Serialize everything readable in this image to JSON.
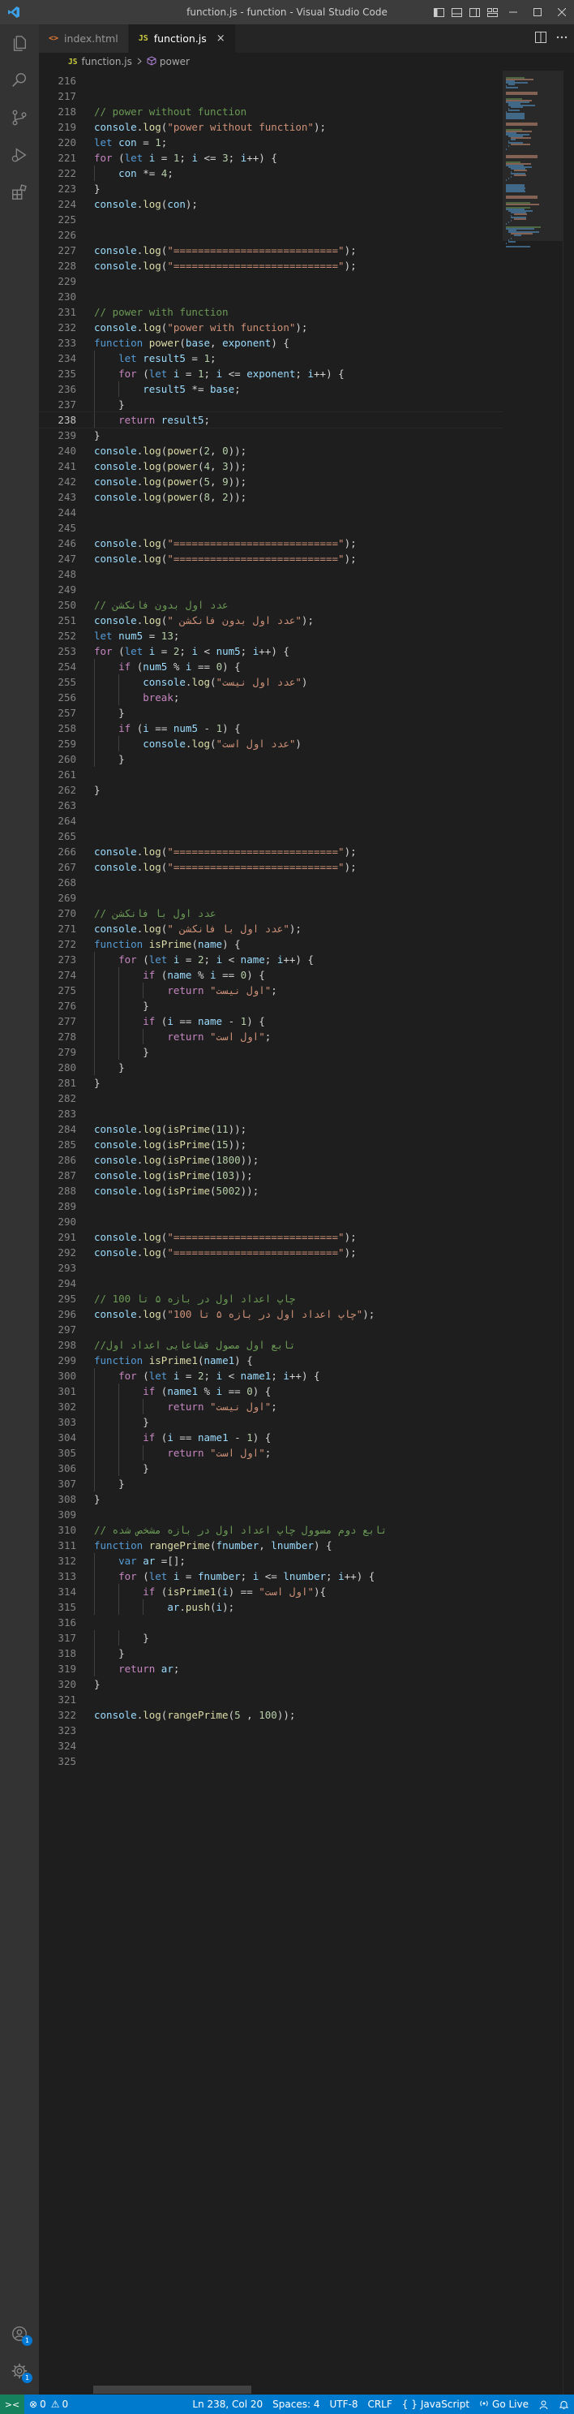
{
  "window": {
    "title": "function.js - function - Visual Studio Code"
  },
  "tabs": [
    {
      "label": "index.html",
      "icon": "html-file-icon",
      "active": false
    },
    {
      "label": "function.js",
      "icon": "js-file-icon",
      "active": true
    }
  ],
  "tab_icons": {
    "html": "<>",
    "js": "JS",
    "close": "×"
  },
  "breadcrumb": {
    "file": "function.js",
    "symbol": "power",
    "file_icon": "JS"
  },
  "editor": {
    "current_line": 238,
    "lines": [
      {
        "n": 216,
        "t": ""
      },
      {
        "n": 217,
        "t": ""
      },
      {
        "n": 218,
        "t": "// power without function"
      },
      {
        "n": 219,
        "t": "console.log(\"power without function\");"
      },
      {
        "n": 220,
        "t": "let con = 1;"
      },
      {
        "n": 221,
        "t": "for (let i = 1; i <= 3; i++) {"
      },
      {
        "n": 222,
        "t": "    con *= 4;"
      },
      {
        "n": 223,
        "t": "}"
      },
      {
        "n": 224,
        "t": "console.log(con);"
      },
      {
        "n": 225,
        "t": ""
      },
      {
        "n": 226,
        "t": ""
      },
      {
        "n": 227,
        "t": "console.log(\"===========================\");"
      },
      {
        "n": 228,
        "t": "console.log(\"===========================\");"
      },
      {
        "n": 229,
        "t": ""
      },
      {
        "n": 230,
        "t": ""
      },
      {
        "n": 231,
        "t": "// power with function"
      },
      {
        "n": 232,
        "t": "console.log(\"power with function\");"
      },
      {
        "n": 233,
        "t": "function power(base, exponent) {"
      },
      {
        "n": 234,
        "t": "    let result5 = 1;"
      },
      {
        "n": 235,
        "t": "    for (let i = 1; i <= exponent; i++) {"
      },
      {
        "n": 236,
        "t": "        result5 *= base;"
      },
      {
        "n": 237,
        "t": "    }"
      },
      {
        "n": 238,
        "t": "    return result5;"
      },
      {
        "n": 239,
        "t": "}"
      },
      {
        "n": 240,
        "t": "console.log(power(2, 0));"
      },
      {
        "n": 241,
        "t": "console.log(power(4, 3));"
      },
      {
        "n": 242,
        "t": "console.log(power(5, 9));"
      },
      {
        "n": 243,
        "t": "console.log(power(8, 2));"
      },
      {
        "n": 244,
        "t": ""
      },
      {
        "n": 245,
        "t": ""
      },
      {
        "n": 246,
        "t": "console.log(\"===========================\");"
      },
      {
        "n": 247,
        "t": "console.log(\"===========================\");"
      },
      {
        "n": 248,
        "t": ""
      },
      {
        "n": 249,
        "t": ""
      },
      {
        "n": 250,
        "t": "// عدد اول بدون فانکشن"
      },
      {
        "n": 251,
        "t": "console.log(\" عدد اول بدون فانکشن\");"
      },
      {
        "n": 252,
        "t": "let num5 = 13;"
      },
      {
        "n": 253,
        "t": "for (let i = 2; i < num5; i++) {"
      },
      {
        "n": 254,
        "t": "    if (num5 % i == 0) {"
      },
      {
        "n": 255,
        "t": "        console.log(\"عدد اول نیست\")"
      },
      {
        "n": 256,
        "t": "        break;"
      },
      {
        "n": 257,
        "t": "    }"
      },
      {
        "n": 258,
        "t": "    if (i == num5 - 1) {"
      },
      {
        "n": 259,
        "t": "        console.log(\"عدد اول است\")"
      },
      {
        "n": 260,
        "t": "    }"
      },
      {
        "n": 261,
        "t": ""
      },
      {
        "n": 262,
        "t": "}"
      },
      {
        "n": 263,
        "t": ""
      },
      {
        "n": 264,
        "t": ""
      },
      {
        "n": 265,
        "t": ""
      },
      {
        "n": 266,
        "t": "console.log(\"===========================\");"
      },
      {
        "n": 267,
        "t": "console.log(\"===========================\");"
      },
      {
        "n": 268,
        "t": ""
      },
      {
        "n": 269,
        "t": ""
      },
      {
        "n": 270,
        "t": "// عدد اول با فانکشن"
      },
      {
        "n": 271,
        "t": "console.log(\" عدد اول با فانکشن\");"
      },
      {
        "n": 272,
        "t": "function isPrime(name) {"
      },
      {
        "n": 273,
        "t": "    for (let i = 2; i < name; i++) {"
      },
      {
        "n": 274,
        "t": "        if (name % i == 0) {"
      },
      {
        "n": 275,
        "t": "            return \"اول نیست\";"
      },
      {
        "n": 276,
        "t": "        }"
      },
      {
        "n": 277,
        "t": "        if (i == name - 1) {"
      },
      {
        "n": 278,
        "t": "            return \"اول است\";"
      },
      {
        "n": 279,
        "t": "        }"
      },
      {
        "n": 280,
        "t": "    }"
      },
      {
        "n": 281,
        "t": "}"
      },
      {
        "n": 282,
        "t": ""
      },
      {
        "n": 283,
        "t": ""
      },
      {
        "n": 284,
        "t": "console.log(isPrime(11));"
      },
      {
        "n": 285,
        "t": "console.log(isPrime(15));"
      },
      {
        "n": 286,
        "t": "console.log(isPrime(1800));"
      },
      {
        "n": 287,
        "t": "console.log(isPrime(103));"
      },
      {
        "n": 288,
        "t": "console.log(isPrime(5002));"
      },
      {
        "n": 289,
        "t": ""
      },
      {
        "n": 290,
        "t": ""
      },
      {
        "n": 291,
        "t": "console.log(\"===========================\");"
      },
      {
        "n": 292,
        "t": "console.log(\"===========================\");"
      },
      {
        "n": 293,
        "t": ""
      },
      {
        "n": 294,
        "t": ""
      },
      {
        "n": 295,
        "t": "// چاپ اعداد اول در بازه ۵ تا 100"
      },
      {
        "n": 296,
        "t": "console.log(\"چاپ اعداد اول در بازه ۵ تا 100\");"
      },
      {
        "n": 297,
        "t": ""
      },
      {
        "n": 298,
        "t": "//تابع اول مصول قشاعایی اعداد اول"
      },
      {
        "n": 299,
        "t": "function isPrime1(name1) {"
      },
      {
        "n": 300,
        "t": "    for (let i = 2; i < name1; i++) {"
      },
      {
        "n": 301,
        "t": "        if (name1 % i == 0) {"
      },
      {
        "n": 302,
        "t": "            return \"اول نیست\";"
      },
      {
        "n": 303,
        "t": "        }"
      },
      {
        "n": 304,
        "t": "        if (i == name1 - 1) {"
      },
      {
        "n": 305,
        "t": "            return \"اول است\";"
      },
      {
        "n": 306,
        "t": "        }"
      },
      {
        "n": 307,
        "t": "    }"
      },
      {
        "n": 308,
        "t": "}"
      },
      {
        "n": 309,
        "t": ""
      },
      {
        "n": 310,
        "t": "// تابع دوم مسوول چاپ اعداد اول در بازه مشخص شده"
      },
      {
        "n": 311,
        "t": "function rangePrime(fnumber, lnumber) {"
      },
      {
        "n": 312,
        "t": "    var ar =[];"
      },
      {
        "n": 313,
        "t": "    for (let i = fnumber; i <= lnumber; i++) {"
      },
      {
        "n": 314,
        "t": "        if (isPrime1(i) == \"اول است\"){"
      },
      {
        "n": 315,
        "t": "            ar.push(i);"
      },
      {
        "n": 316,
        "t": ""
      },
      {
        "n": 317,
        "t": "        }"
      },
      {
        "n": 318,
        "t": "    }"
      },
      {
        "n": 319,
        "t": "    return ar;"
      },
      {
        "n": 320,
        "t": "}"
      },
      {
        "n": 321,
        "t": ""
      },
      {
        "n": 322,
        "t": "console.log(rangePrime(5 , 100));"
      },
      {
        "n": 323,
        "t": ""
      },
      {
        "n": 324,
        "t": ""
      },
      {
        "n": 325,
        "t": ""
      }
    ]
  },
  "statusbar": {
    "remote": "><",
    "errors": "0",
    "warnings": "0",
    "position": "Ln 238, Col 20",
    "spaces": "Spaces: 4",
    "encoding": "UTF-8",
    "eol": "CRLF",
    "language": "JavaScript",
    "language_icon": "{ }",
    "golive": "Go Live",
    "error_glyph": "⊗",
    "warning_glyph": "⚠"
  },
  "activity": {
    "account_badge": "1",
    "settings_badge": "1"
  },
  "colors": {
    "accent": "#007acc",
    "titlebar": "#3c3c3c",
    "activitybar": "#333333",
    "editor_bg": "#1e1e1e",
    "comment": "#6a9955",
    "string": "#ce9178",
    "keyword": "#569cd6"
  }
}
